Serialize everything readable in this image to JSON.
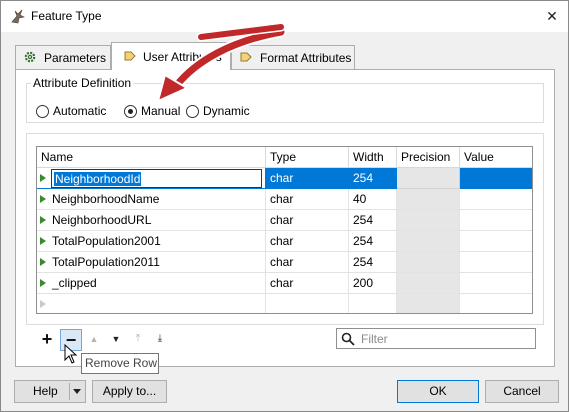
{
  "window": {
    "title": "Feature Type",
    "close_glyph": "✕",
    "icon": "fme-feature-type-icon"
  },
  "tabs": [
    {
      "label": "Parameters",
      "icon": "gear-icon",
      "active": false
    },
    {
      "label": "User Attributes",
      "icon": "attribute-arrow-icon",
      "active": true
    },
    {
      "label": "Format Attributes",
      "icon": "attribute-arrow-icon",
      "active": false
    }
  ],
  "attribute_definition": {
    "title": "Attribute Definition",
    "options": [
      {
        "label": "Automatic",
        "checked": false
      },
      {
        "label": "Manual",
        "checked": true
      },
      {
        "label": "Dynamic",
        "checked": false
      }
    ]
  },
  "table": {
    "headers": [
      "Name",
      "Type",
      "Width",
      "Precision",
      "Value"
    ],
    "rows": [
      {
        "name": "NeighborhoodId",
        "type": "char",
        "width": "254",
        "precision": "",
        "value": "",
        "selected": true
      },
      {
        "name": "NeighborhoodName",
        "type": "char",
        "width": "40",
        "precision": "",
        "value": ""
      },
      {
        "name": "NeighborhoodURL",
        "type": "char",
        "width": "254",
        "precision": "",
        "value": ""
      },
      {
        "name": "TotalPopulation2001",
        "type": "char",
        "width": "254",
        "precision": "",
        "value": ""
      },
      {
        "name": "TotalPopulation2011",
        "type": "char",
        "width": "254",
        "precision": "",
        "value": ""
      },
      {
        "name": "_clipped",
        "type": "char",
        "width": "200",
        "precision": "",
        "value": ""
      }
    ]
  },
  "toolbar": {
    "add_glyph": "+",
    "remove_glyph": "−",
    "up_glyph": "▲",
    "down_glyph": "▼",
    "top_glyph": "⤒",
    "bottom_glyph": "⤓"
  },
  "filter": {
    "placeholder": "Filter",
    "icon": "search-icon"
  },
  "tooltip": {
    "text": "Remove Row"
  },
  "buttons": {
    "help": "Help",
    "apply": "Apply to...",
    "ok": "OK",
    "cancel": "Cancel"
  },
  "colors": {
    "selection": "#0078d7",
    "annotation_arrow": "#c0282a",
    "row_marker": "#3a8a2e"
  }
}
